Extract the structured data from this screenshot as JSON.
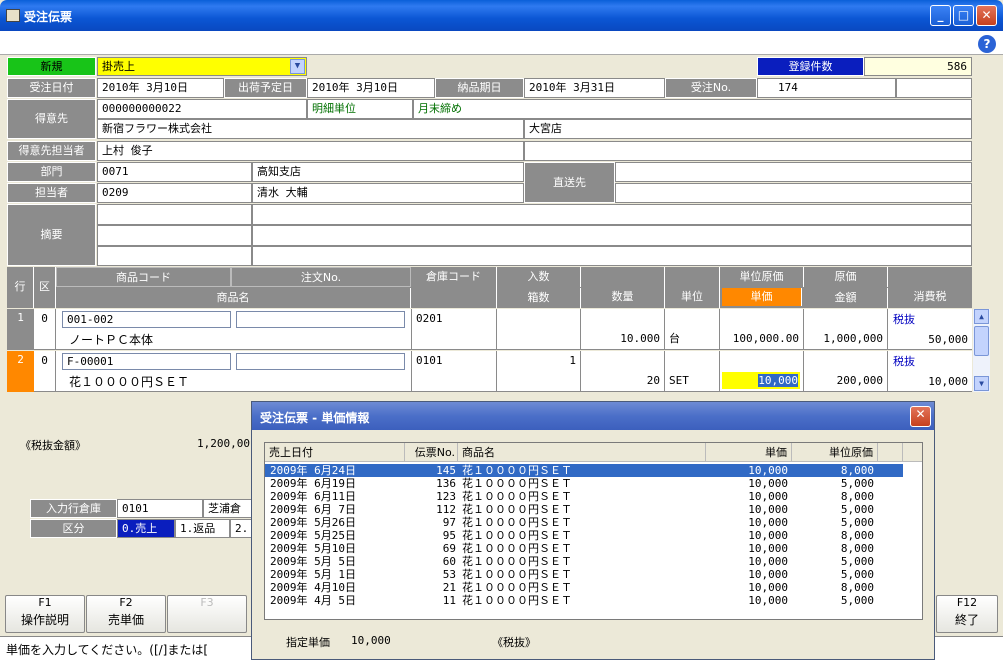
{
  "window": {
    "title": "受注伝票",
    "min": "_",
    "max": "□",
    "close": "✕",
    "help": "?"
  },
  "top": {
    "mode": "新規",
    "category": "掛売上",
    "count_label": "登録件数",
    "count_value": "586"
  },
  "row1": {
    "order_date_label": "受注日付",
    "order_date": "2010年 3月10日",
    "ship_date_label": "出荷予定日",
    "ship_date": "2010年 3月10日",
    "deliver_label": "納品期日",
    "deliver_date": "2010年 3月31日",
    "order_no_label": "受注No.",
    "order_no": "174"
  },
  "customer": {
    "label": "得意先",
    "code": "000000000022",
    "detail_label": "明細単位",
    "closing": "月末締め",
    "name": "新宿フラワー株式会社",
    "store": "大宮店"
  },
  "contact": {
    "label": "得意先担当者",
    "name": "上村 俊子"
  },
  "dept": {
    "label": "部門",
    "code": "0071",
    "name": "高知支店"
  },
  "staff": {
    "label": "担当者",
    "code": "0209",
    "name": "清水 大輔"
  },
  "direct_label": "直送先",
  "memo_label": "摘要",
  "grid": {
    "h_row": "行",
    "h_kbn": "区",
    "h_code": "商品コード",
    "h_order": "注文No.",
    "h_name": "商品名",
    "h_wh": "倉庫コード",
    "h_irisu": "入数",
    "h_hako": "箱数",
    "h_qty": "数量",
    "h_unit": "単位",
    "h_ucost": "単位原価",
    "h_price": "単価",
    "h_cost": "原価",
    "h_amount": "金額",
    "h_tax": "消費税",
    "rows": [
      {
        "no": "1",
        "kbn": "0",
        "code": "001-002",
        "name": "ノートＰＣ本体",
        "wh": "0201",
        "irisu": "",
        "qty": "10.000",
        "unit": "台",
        "ucost": "",
        "price": "100,000.00",
        "amount": "1,000,000",
        "taxtype": "税抜",
        "tax": "50,000"
      },
      {
        "no": "2",
        "kbn": "0",
        "code": "F-00001",
        "name": "花１００００円ＳＥＴ",
        "wh": "0101",
        "irisu": "1",
        "qty": "20",
        "unit": "SET",
        "ucost": "",
        "price": "10,000",
        "amount": "200,000",
        "taxtype": "税抜",
        "tax": "10,000"
      }
    ]
  },
  "summary": {
    "label": "《税抜金額》",
    "value": "1,200,00"
  },
  "input": {
    "wh_label": "入力行倉庫",
    "wh_code": "0101",
    "wh_name": "芝浦倉",
    "kbn_label": "区分",
    "kbn_opt0": "0.売上",
    "kbn_opt1": "1.返品",
    "kbn_opt2": "2."
  },
  "fkeys": [
    {
      "key": "F1",
      "label": "操作説明"
    },
    {
      "key": "F2",
      "label": "売単価"
    },
    {
      "key": "F3",
      "label": ""
    },
    {
      "key": "F12",
      "label": "終了"
    }
  ],
  "status": "単価を入力してください。([/]または[",
  "popup": {
    "title": "受注伝票 - 単価情報",
    "close": "✕",
    "headers": {
      "date": "売上日付",
      "slip": "伝票No.",
      "name": "商品名",
      "price": "単価",
      "ucost": "単位原価"
    },
    "rows": [
      {
        "date": "2009年 6月24日",
        "slip": "145",
        "name": "花１００００円ＳＥＴ",
        "price": "10,000",
        "ucost": "8,000"
      },
      {
        "date": "2009年 6月19日",
        "slip": "136",
        "name": "花１００００円ＳＥＴ",
        "price": "10,000",
        "ucost": "5,000"
      },
      {
        "date": "2009年 6月11日",
        "slip": "123",
        "name": "花１００００円ＳＥＴ",
        "price": "10,000",
        "ucost": "8,000"
      },
      {
        "date": "2009年 6月 7日",
        "slip": "112",
        "name": "花１００００円ＳＥＴ",
        "price": "10,000",
        "ucost": "5,000"
      },
      {
        "date": "2009年 5月26日",
        "slip": "97",
        "name": "花１００００円ＳＥＴ",
        "price": "10,000",
        "ucost": "5,000"
      },
      {
        "date": "2009年 5月25日",
        "slip": "95",
        "name": "花１００００円ＳＥＴ",
        "price": "10,000",
        "ucost": "8,000"
      },
      {
        "date": "2009年 5月10日",
        "slip": "69",
        "name": "花１００００円ＳＥＴ",
        "price": "10,000",
        "ucost": "8,000"
      },
      {
        "date": "2009年 5月 5日",
        "slip": "60",
        "name": "花１００００円ＳＥＴ",
        "price": "10,000",
        "ucost": "5,000"
      },
      {
        "date": "2009年 5月 1日",
        "slip": "53",
        "name": "花１００００円ＳＥＴ",
        "price": "10,000",
        "ucost": "5,000"
      },
      {
        "date": "2009年 4月10日",
        "slip": "21",
        "name": "花１００００円ＳＥＴ",
        "price": "10,000",
        "ucost": "8,000"
      },
      {
        "date": "2009年 4月 5日",
        "slip": "11",
        "name": "花１００００円ＳＥＴ",
        "price": "10,000",
        "ucost": "5,000"
      }
    ],
    "spec_label": "指定単価",
    "spec_value": "10,000",
    "spec_tax": "《税抜》"
  }
}
